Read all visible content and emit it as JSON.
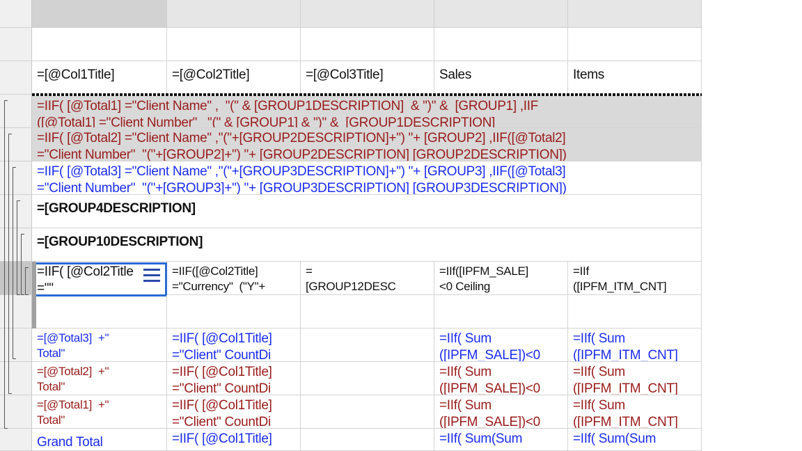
{
  "header_row": {
    "col1": "=[@Col1Title]",
    "col2": "=[@Col2Title]",
    "col3": "=[@Col3Title]",
    "col4": "Sales",
    "col5": "Items"
  },
  "group_rows": [
    {
      "line1": "=IIF( [@Total1] =\"Client Name\" ,  \"(\" & [GROUP1DESCRIPTION]  & \")\" &  [GROUP1] ,IIF",
      "line2": "([@Total1] =\"Client Number\"   \"(\" & [GROUP1] & \")\" &  [GROUP1DESCRIPTION]"
    },
    {
      "line1": "=IIF( [@Total2] =\"Client Name\" ,\"(\"+[GROUP2DESCRIPTION]+\") \"+ [GROUP2] ,IIF([@Total2]",
      "line2": "=\"Client Number\"  \"(\"+[GROUP2]+\") \"+ [GROUP2DESCRIPTION] [GROUP2DESCRIPTION])"
    },
    {
      "line1": "=IIF( [@Total3] =\"Client Name\" ,\"(\"+[GROUP3DESCRIPTION]+\") \"+ [GROUP3] ,IIF([@Total3]",
      "line2": "=\"Client Number\"  \"(\"+[GROUP3]+\") \"+ [GROUP3DESCRIPTION] [GROUP3DESCRIPTION])"
    },
    {
      "line1": "=[GROUP4DESCRIPTION]"
    },
    {
      "line1": "=[GROUP10DESCRIPTION]"
    }
  ],
  "detail_row": {
    "col1": "=IIF( [@Col2Title\n=\"\"",
    "col2": "=IIF([@Col2Title]\n=\"Currency\"  (\"Y\"+",
    "col3": "=\n[GROUP12DESC",
    "col4": "=IIf([IPFM_SALE]\n<0 Ceiling",
    "col5": "=IIf\n([IPFM_ITM_CNT]"
  },
  "total_rows": [
    {
      "col1": "=[@Total3]  +\"\nTotal\"",
      "col2": "=IIF( [@Col1Title]\n=\"Client\" CountDi",
      "col4": "=IIf( Sum\n([IPFM_SALE])<0",
      "col5": "=IIf( Sum\n([IPFM_ITM_CNT]"
    },
    {
      "col1": "=[@Total2]  +\"\nTotal\"",
      "col2": "=IIF( [@Col1Title]\n=\"Client\" CountDi",
      "col4": "=IIf( Sum\n([IPFM_SALE])<0",
      "col5": "=IIf( Sum\n([IPFM_ITM_CNT]"
    },
    {
      "col1": "=[@Total1]  +\"\nTotal\"",
      "col2": "=IIF( [@Col1Title]\n=\"Client\" CountDi",
      "col4": "=IIf( Sum\n([IPFM_SALE])<0",
      "col5": "=IIf( Sum\n([IPFM_ITM_CNT]"
    },
    {
      "col1": "Grand Total",
      "col2": "=IIF( [@Col1Title]",
      "col4": "=IIf( Sum(Sum",
      "col5": "=IIf( Sum(Sum"
    }
  ],
  "colors": {
    "dark_red": "#9a1b1b",
    "blue": "#1b2cf0",
    "group_fill": "#d9d9d9",
    "selection": "#2b6ad6"
  },
  "icons": [
    "row-handle-menu-icon",
    "group-bracket-icon"
  ]
}
